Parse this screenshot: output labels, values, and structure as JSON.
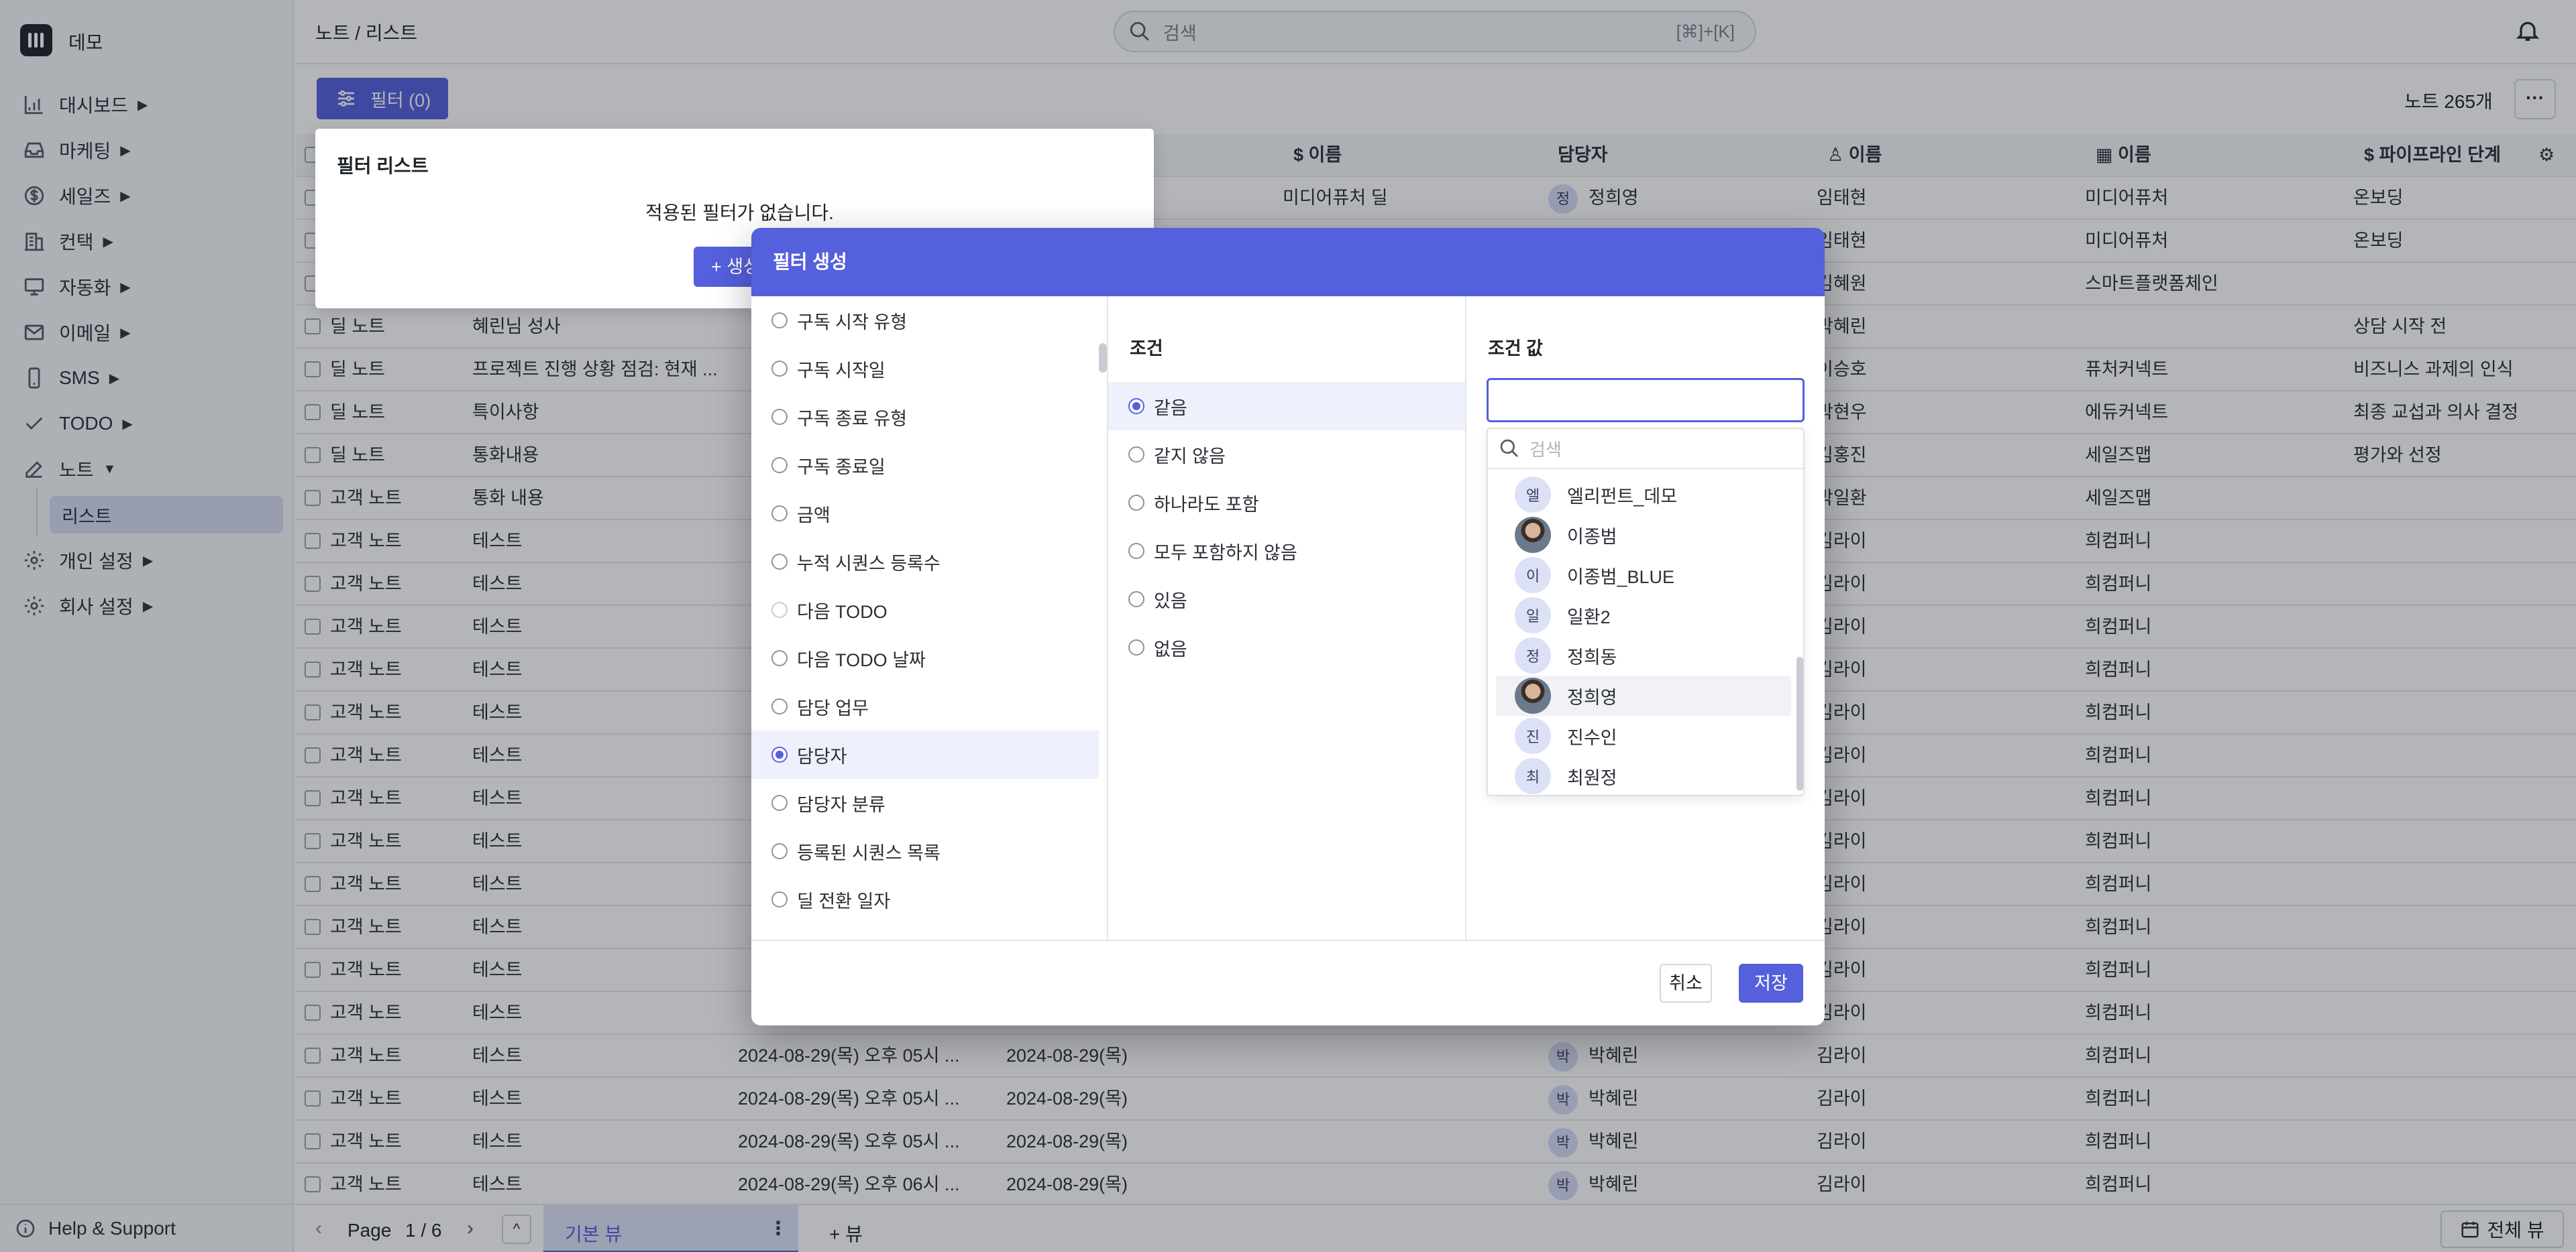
{
  "app": {
    "name": "데모"
  },
  "sidebar": {
    "items": [
      {
        "label": "대시보드",
        "arrow": "▶"
      },
      {
        "label": "마케팅",
        "arrow": "▶"
      },
      {
        "label": "세일즈",
        "arrow": "▶"
      },
      {
        "label": "컨택",
        "arrow": "▶"
      },
      {
        "label": "자동화",
        "arrow": "▶"
      },
      {
        "label": "이메일",
        "arrow": "▶"
      },
      {
        "label": "SMS",
        "arrow": "▶"
      },
      {
        "label": "TODO",
        "arrow": "▶"
      },
      {
        "label": "노트",
        "arrow": "▼"
      }
    ],
    "sub_item": "리스트",
    "bottom_items": [
      {
        "label": "개인 설정",
        "arrow": "▶"
      },
      {
        "label": "회사 설정",
        "arrow": "▶"
      }
    ],
    "help": "Help & Support"
  },
  "header": {
    "breadcrumb": "노트 / 리스트",
    "search_placeholder": "검색",
    "search_shortcut": "[⌘]+[K]"
  },
  "toolbar": {
    "filter_label": "필터 (0)",
    "count": "노트 265개",
    "more": "···"
  },
  "table": {
    "headers": [
      "이름",
      "담당자",
      "이름",
      "이름",
      "파이프라인 단계"
    ],
    "rows": [
      [
        "",
        "",
        "",
        "",
        "미디어퓨처 딜",
        "정희영",
        "임태현",
        "미디어퓨처",
        "온보딩"
      ],
      [
        "",
        "",
        "",
        "",
        "",
        "",
        "임태현",
        "미디어퓨처",
        "온보딩"
      ],
      [
        "",
        "",
        "",
        "",
        "",
        "",
        "김혜원",
        "스마트플랫폼체인",
        ""
      ],
      [
        "딜 노트",
        "혜린님 성사",
        "",
        "",
        "",
        "",
        "박혜린",
        "",
        "상담 시작 전"
      ],
      [
        "딜 노트",
        "프로젝트 진행 상황 점검: 현재 ...",
        "",
        "",
        "",
        "",
        "이승호",
        "퓨처커넥트",
        "비즈니스 과제의 인식"
      ],
      [
        "딜 노트",
        "특이사항",
        "",
        "",
        "",
        "",
        "박현우",
        "에듀커넥트",
        "최종 교섭과 의사 결정"
      ],
      [
        "딜 노트",
        "통화내용",
        "",
        "",
        "",
        "",
        "김홍진",
        "세일즈맵",
        "평가와 선정"
      ],
      [
        "고객 노트",
        "통화 내용",
        "",
        "",
        "",
        "",
        "박일환",
        "세일즈맵",
        ""
      ],
      [
        "고객 노트",
        "테스트",
        "",
        "",
        "",
        "",
        "김라이",
        "희컴퍼니",
        ""
      ],
      [
        "고객 노트",
        "테스트",
        "",
        "",
        "",
        "",
        "김라이",
        "희컴퍼니",
        ""
      ],
      [
        "고객 노트",
        "테스트",
        "",
        "",
        "",
        "",
        "김라이",
        "희컴퍼니",
        ""
      ],
      [
        "고객 노트",
        "테스트",
        "",
        "",
        "",
        "",
        "김라이",
        "희컴퍼니",
        ""
      ],
      [
        "고객 노트",
        "테스트",
        "",
        "",
        "",
        "",
        "김라이",
        "희컴퍼니",
        ""
      ],
      [
        "고객 노트",
        "테스트",
        "",
        "",
        "",
        "",
        "김라이",
        "희컴퍼니",
        ""
      ],
      [
        "고객 노트",
        "테스트",
        "",
        "",
        "",
        "",
        "김라이",
        "희컴퍼니",
        ""
      ],
      [
        "고객 노트",
        "테스트",
        "",
        "",
        "",
        "",
        "김라이",
        "희컴퍼니",
        ""
      ],
      [
        "고객 노트",
        "테스트",
        "",
        "",
        "",
        "",
        "김라이",
        "희컴퍼니",
        ""
      ],
      [
        "고객 노트",
        "테스트",
        "",
        "",
        "",
        "",
        "김라이",
        "희컴퍼니",
        ""
      ],
      [
        "고객 노트",
        "테스트",
        "",
        "",
        "",
        "",
        "김라이",
        "희컴퍼니",
        ""
      ],
      [
        "고객 노트",
        "테스트",
        "",
        "",
        "",
        "",
        "김라이",
        "희컴퍼니",
        ""
      ],
      [
        "고객 노트",
        "테스트",
        "2024-08-29(목) 오후 05시 ...",
        "2024-08-29(목)",
        "",
        "박혜린",
        "김라이",
        "희컴퍼니",
        ""
      ],
      [
        "고객 노트",
        "테스트",
        "2024-08-29(목) 오후 05시 ...",
        "2024-08-29(목)",
        "",
        "박혜린",
        "김라이",
        "희컴퍼니",
        ""
      ],
      [
        "고객 노트",
        "테스트",
        "2024-08-29(목) 오후 05시 ...",
        "2024-08-29(목)",
        "",
        "박혜린",
        "김라이",
        "희컴퍼니",
        ""
      ],
      [
        "고객 노트",
        "테스트",
        "2024-08-29(목) 오후 06시 ...",
        "2024-08-29(목)",
        "",
        "박혜린",
        "김라이",
        "희컴퍼니",
        ""
      ]
    ]
  },
  "filter_list": {
    "title": "필터 리스트",
    "empty": "적용된 필터가 없습니다.",
    "add": "+ 생성"
  },
  "modal": {
    "title": "필터 생성",
    "fields": [
      {
        "label": "구독 시작 유형",
        "state": "off"
      },
      {
        "label": "구독 시작일",
        "state": "off"
      },
      {
        "label": "구독 종료 유형",
        "state": "off"
      },
      {
        "label": "구독 종료일",
        "state": "off"
      },
      {
        "label": "금액",
        "state": "off"
      },
      {
        "label": "누적 시퀀스 등록수",
        "state": "off"
      },
      {
        "label": "다음 TODO",
        "state": "disabled"
      },
      {
        "label": "다음 TODO 날짜",
        "state": "off"
      },
      {
        "label": "담당 업무",
        "state": "off"
      },
      {
        "label": "담당자",
        "state": "on"
      },
      {
        "label": "담당자 분류",
        "state": "off"
      },
      {
        "label": "등록된 시퀀스 목록",
        "state": "off"
      },
      {
        "label": "딜 전환 일자",
        "state": "off"
      }
    ],
    "condition_title": "조건",
    "conditions": [
      {
        "label": "같음",
        "state": "on"
      },
      {
        "label": "같지 않음",
        "state": "off"
      },
      {
        "label": "하나라도 포함",
        "state": "off"
      },
      {
        "label": "모두 포함하지 않음",
        "state": "off"
      },
      {
        "label": "있음",
        "state": "off"
      },
      {
        "label": "없음",
        "state": "off"
      }
    ],
    "value_title": "조건 값",
    "value_input": "",
    "dropdown_search_placeholder": "검색",
    "users": [
      {
        "initial": "엘",
        "name": "엘리펀트_데모",
        "photo": false
      },
      {
        "initial": "",
        "name": "이종범",
        "photo": true
      },
      {
        "initial": "이",
        "name": "이종범_BLUE",
        "photo": false
      },
      {
        "initial": "일",
        "name": "일환2",
        "photo": false
      },
      {
        "initial": "정",
        "name": "정희동",
        "photo": false
      },
      {
        "initial": "",
        "name": "정희영",
        "photo": true
      },
      {
        "initial": "진",
        "name": "진수인",
        "photo": false
      },
      {
        "initial": "최",
        "name": "최원정",
        "photo": false
      }
    ],
    "cancel": "취소",
    "save": "저장"
  },
  "footer": {
    "page_label": "Page",
    "page_value": "1 / 6",
    "view_tab": "기본 뷰",
    "add_view": "+ 뷰",
    "full_view": "전체 뷰"
  },
  "colors": {
    "accent": "#5560dc",
    "sidebar_bg": "#f7f8fa",
    "selected_bg": "#d8ddf2"
  }
}
